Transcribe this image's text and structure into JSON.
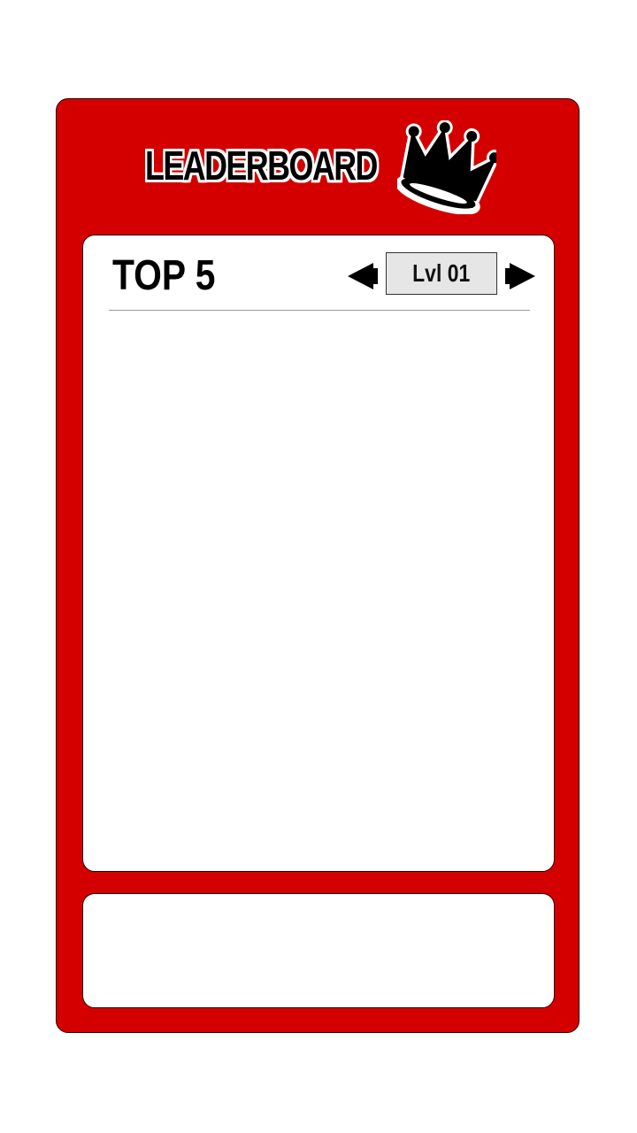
{
  "header": {
    "title": "LEADERBOARD",
    "icon": "crown-icon"
  },
  "leaderboard": {
    "top_label": "TOP 5",
    "level_label": "Lvl 01",
    "prev_icon": "arrow-left-icon",
    "next_icon": "arrow-right-icon",
    "entries": []
  },
  "colors": {
    "frame": "#d40000",
    "panel": "#ffffff",
    "level_box": "#e6e6e6"
  }
}
